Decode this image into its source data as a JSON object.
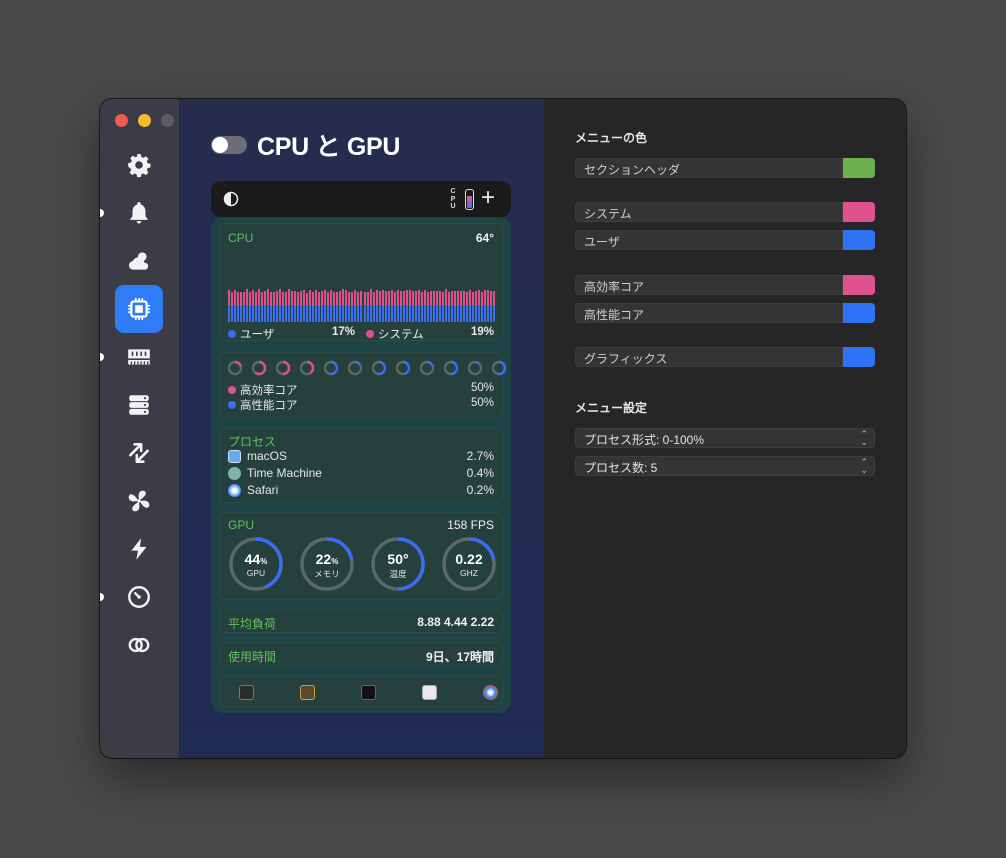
{
  "window": {
    "title": "CPU と GPU"
  },
  "sidebar": {
    "items": [
      {
        "icon": "gear-icon"
      },
      {
        "icon": "bell-icon"
      },
      {
        "icon": "weather-icon"
      },
      {
        "icon": "cpu-icon",
        "active": true
      },
      {
        "icon": "memory-icon"
      },
      {
        "icon": "disk-icon"
      },
      {
        "icon": "network-arrows-icon"
      },
      {
        "icon": "fan-icon"
      },
      {
        "icon": "bolt-icon"
      },
      {
        "icon": "clock-icon"
      },
      {
        "icon": "link-rings-icon"
      }
    ]
  },
  "menubar": {
    "cpu_text": "CPU"
  },
  "cpu": {
    "label": "CPU",
    "temp": "64°",
    "user_label": "ユーザ",
    "user_value": "17%",
    "system_label": "システム",
    "system_value": "19%",
    "history_user": [
      0.44,
      0.42,
      0.45,
      0.43,
      0.41,
      0.44,
      0.46,
      0.42,
      0.44,
      0.43,
      0.45,
      0.42,
      0.44,
      0.46,
      0.43,
      0.41,
      0.44,
      0.45,
      0.42,
      0.43,
      0.46,
      0.44,
      0.42,
      0.45,
      0.43,
      0.44,
      0.41,
      0.45,
      0.43,
      0.44,
      0.42,
      0.46,
      0.44,
      0.43,
      0.45,
      0.42,
      0.44,
      0.43,
      0.45,
      0.46,
      0.42,
      0.44,
      0.43,
      0.41,
      0.45,
      0.44,
      0.42,
      0.46,
      0.43,
      0.44,
      0.45,
      0.42,
      0.43,
      0.44,
      0.46,
      0.42,
      0.44,
      0.43,
      0.45,
      0.44,
      0.42,
      0.45,
      0.43,
      0.44,
      0.42,
      0.46,
      0.43,
      0.44,
      0.42,
      0.45,
      0.43,
      0.44,
      0.46,
      0.42,
      0.44,
      0.43,
      0.45,
      0.42,
      0.44,
      0.43,
      0.45,
      0.44,
      0.42,
      0.46,
      0.43,
      0.44,
      0.42,
      0.45,
      0.43
    ],
    "history_system": [
      0.4,
      0.37,
      0.39,
      0.36,
      0.38,
      0.35,
      0.4,
      0.37,
      0.39,
      0.36,
      0.41,
      0.37,
      0.38,
      0.4,
      0.36,
      0.39,
      0.37,
      0.41,
      0.38,
      0.36,
      0.4,
      0.37,
      0.39,
      0.35,
      0.38,
      0.4,
      0.36,
      0.39,
      0.37,
      0.41,
      0.38,
      0.36,
      0.39,
      0.37,
      0.4,
      0.38,
      0.36,
      0.39,
      0.41,
      0.37,
      0.38,
      0.36,
      0.4,
      0.39,
      0.37,
      0.35,
      0.38,
      0.4,
      0.37,
      0.39,
      0.36,
      0.41,
      0.38,
      0.37,
      0.39,
      0.36,
      0.4,
      0.38,
      0.37,
      0.39,
      0.41,
      0.36,
      0.38,
      0.4,
      0.37,
      0.39,
      0.36,
      0.38,
      0.4,
      0.37,
      0.39,
      0.36,
      0.41,
      0.38,
      0.37,
      0.39,
      0.36,
      0.4,
      0.38,
      0.37,
      0.39,
      0.36,
      0.4,
      0.38,
      0.37,
      0.39,
      0.41,
      0.36,
      0.38
    ]
  },
  "cores": {
    "rings": [
      {
        "color": "#e0518f",
        "fraction": 0.2
      },
      {
        "color": "#e0518f",
        "fraction": 0.6
      },
      {
        "color": "#e0518f",
        "fraction": 0.5
      },
      {
        "color": "#e0518f",
        "fraction": 0.4
      },
      {
        "color": "#3a6df2",
        "fraction": 0.5
      },
      {
        "color": "#3a6df2",
        "fraction": 0.15
      },
      {
        "color": "#3a6df2",
        "fraction": 0.55
      },
      {
        "color": "#3a6df2",
        "fraction": 0.45
      },
      {
        "color": "#3a6df2",
        "fraction": 0.2
      },
      {
        "color": "#3a6df2",
        "fraction": 0.5
      },
      {
        "color": "#3a6df2",
        "fraction": 0.1
      },
      {
        "color": "#3a6df2",
        "fraction": 0.55
      }
    ],
    "efficiency_label": "高効率コア",
    "efficiency_value": "50%",
    "performance_label": "高性能コア",
    "performance_value": "50%"
  },
  "processes": {
    "title": "プロセス",
    "items": [
      {
        "name": "macOS",
        "value": "2.7%",
        "icon": "macos-icon"
      },
      {
        "name": "Time Machine",
        "value": "0.4%",
        "icon": "time-machine-icon"
      },
      {
        "name": "Safari",
        "value": "0.2%",
        "icon": "safari-icon"
      }
    ]
  },
  "gpu": {
    "label": "GPU",
    "fps": "158 FPS",
    "gauges": [
      {
        "value": "44",
        "unit": "%",
        "label": "GPU",
        "fraction": 0.44
      },
      {
        "value": "22",
        "unit": "%",
        "label": "メモリ",
        "fraction": 0.22
      },
      {
        "value": "50°",
        "unit": "",
        "label": "温度",
        "fraction": 0.5
      },
      {
        "value": "0.22",
        "unit": "",
        "label": "GHZ",
        "fraction": 0.22
      }
    ]
  },
  "load": {
    "label": "平均負荷",
    "value": "8.88 4.44 2.22"
  },
  "uptime": {
    "label": "使用時間",
    "value": "9日、17時間"
  },
  "dock": {
    "items": [
      {
        "icon": "activity-monitor-icon"
      },
      {
        "icon": "system-info-icon"
      },
      {
        "icon": "terminal-icon"
      },
      {
        "icon": "keychain-icon"
      },
      {
        "icon": "safari-icon"
      }
    ]
  },
  "settings": {
    "menu_colors_title": "メニューの色",
    "colors": [
      {
        "label": "セクションヘッダ",
        "color": "#6ab04c"
      },
      {
        "label": "システム",
        "color": "#e0518f"
      },
      {
        "label": "ユーザ",
        "color": "#2f72f5"
      },
      {
        "label": "高効率コア",
        "color": "#e0518f"
      },
      {
        "label": "高性能コア",
        "color": "#2f72f5"
      },
      {
        "label": "グラフィックス",
        "color": "#2f72f5"
      }
    ],
    "menu_settings_title": "メニュー設定",
    "process_format": "プロセス形式: 0-100%",
    "process_count": "プロセス数: 5"
  }
}
